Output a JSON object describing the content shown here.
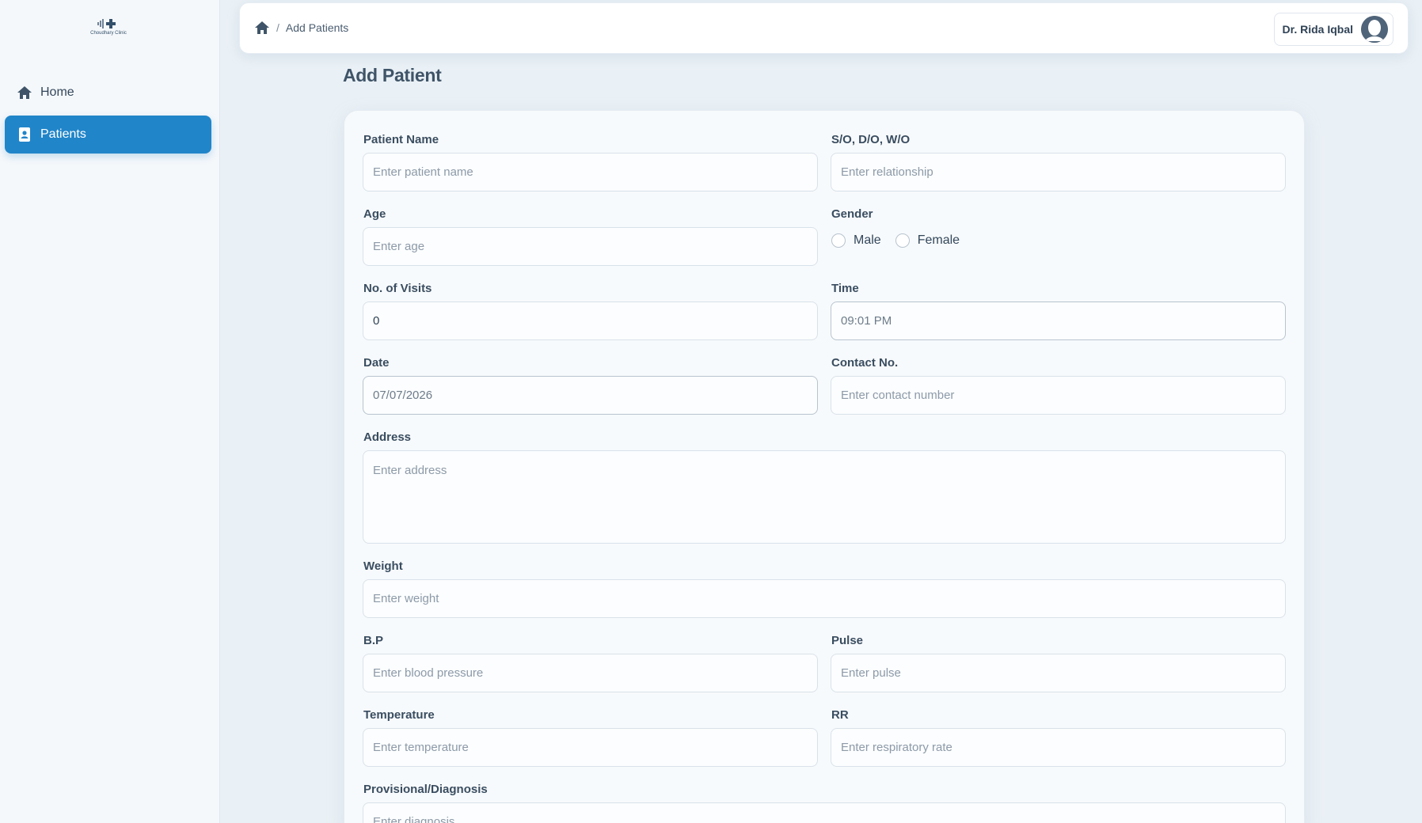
{
  "brand": {
    "logo_text": "Choudhary Clinic"
  },
  "sidebar": {
    "items": [
      {
        "label": "Home",
        "icon": "home-icon"
      },
      {
        "label": "Patients",
        "icon": "contact-book-icon",
        "active": true
      }
    ]
  },
  "header": {
    "breadcrumb": {
      "home_icon": "home-icon",
      "separator": "/",
      "current": "Add Patients"
    },
    "user": {
      "name": "Dr. Rida Iqbal",
      "avatar_icon": "user-avatar-icon"
    }
  },
  "page": {
    "title": "Add Patient"
  },
  "form": {
    "patient_name": {
      "label": "Patient Name",
      "placeholder": "Enter patient name",
      "value": ""
    },
    "relation": {
      "label": "S/O, D/O, W/O",
      "placeholder": "Enter relationship",
      "value": ""
    },
    "age": {
      "label": "Age",
      "placeholder": "Enter age",
      "value": ""
    },
    "gender": {
      "label": "Gender",
      "options": [
        "Male",
        "Female"
      ],
      "selected": ""
    },
    "visits": {
      "label": "No. of Visits",
      "value": "0"
    },
    "time": {
      "label": "Time",
      "value": "09:01 PM"
    },
    "date": {
      "label": "Date",
      "value": "07/07/2026"
    },
    "contact": {
      "label": "Contact No.",
      "placeholder": "Enter contact number",
      "value": ""
    },
    "address": {
      "label": "Address",
      "placeholder": "Enter address",
      "value": ""
    },
    "weight": {
      "label": "Weight",
      "placeholder": "Enter weight",
      "value": ""
    },
    "bp": {
      "label": "B.P",
      "placeholder": "Enter blood pressure",
      "value": ""
    },
    "pulse": {
      "label": "Pulse",
      "placeholder": "Enter pulse",
      "value": ""
    },
    "temperature": {
      "label": "Temperature",
      "placeholder": "Enter temperature",
      "value": ""
    },
    "rr": {
      "label": "RR",
      "placeholder": "Enter respiratory rate",
      "value": ""
    },
    "diagnosis": {
      "label": "Provisional/Diagnosis",
      "placeholder": "Enter diagnosis",
      "value": ""
    }
  },
  "colors": {
    "accent": "#2185c9",
    "background": "#eaf1f6",
    "text": "#2f4255"
  }
}
